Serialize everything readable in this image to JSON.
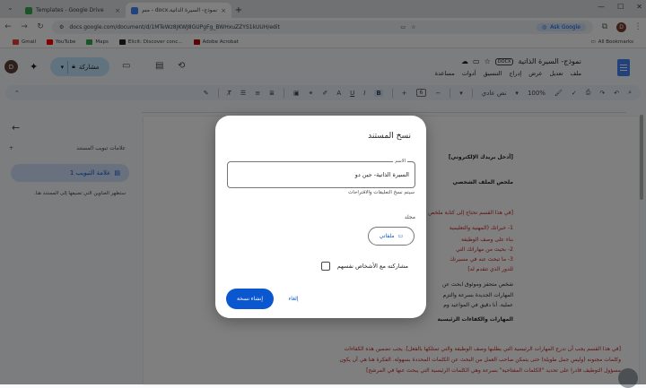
{
  "browser": {
    "tabs": [
      {
        "label": "Templates - Google Drive",
        "active": false
      },
      {
        "label": "نموذج- السيرة الذاتية.docx - مس",
        "active": true
      }
    ],
    "url": "docs.google.com/document/d/1MTeWz8JKWJ8GUPgFg_BWHxuZZYS1kUUH/edit",
    "ask_google": "Ask Google",
    "bookmarks": [
      "Gmail",
      "YouTube",
      "Maps",
      "Elicit: Discover conc...",
      "Adobe Acrobat"
    ],
    "all_bookmarks": "All Bookmarks"
  },
  "docs": {
    "avatar_letter": "D",
    "share_label": "مشاركة",
    "title": "نموذج- السيرة الذاتية",
    "badge": "DOCX",
    "menus": [
      "ملف",
      "تعديل",
      "عرض",
      "إدراج",
      "التنسيق",
      "أدوات",
      "مساعدة"
    ],
    "toolbar": {
      "zoom": "100%",
      "style": "نص عادي",
      "font_size": "6"
    }
  },
  "sidebar": {
    "heading": "علامات تبويب المستند",
    "tab_item": "علامة التبويب 1",
    "note": "ستظهر العناوين التي تضيفها إلى المستند هنا."
  },
  "document_lines": [
    {
      "text": "[أدخل بريدك الإلكتروني]",
      "style": "bold"
    },
    {
      "text": "ملخص الملف الشخصي",
      "style": "bold"
    },
    {
      "text": "[في هذا القسم تحتاج إلى كتابة ملخص",
      "style": "red"
    },
    {
      "text": "1- خبراتك (المهنية والتعليمية",
      "style": "red"
    },
    {
      "text": "بناء على وصف الوظيفة",
      "style": "red"
    },
    {
      "text": "2- بحيث من مهاراتك التي",
      "style": "red"
    },
    {
      "text": "3- ما تبحث عنه في مسيرتك",
      "style": "red"
    },
    {
      "text": "للدور الذي تتقدم له]",
      "style": "red"
    },
    {
      "text": "شخص متحفز وموثوق ابحث عن",
      "style": "dark"
    },
    {
      "text": "المهارات الجديدة بسرعة والتزم",
      "style": "dark"
    },
    {
      "text": "عملية. أنا دقيق في المواعيد وم",
      "style": "dark"
    },
    {
      "text": "المهارات والكفاءات الرئيسية",
      "style": "bold"
    },
    {
      "text": "[في هذا القسم يجب أن تدرج المهارات الرئيسية التي يطلبها وصف الوظيفة والتي تمتلكها بالفعل]. يجب تضمين هذه الكفاءات",
      "style": "red"
    },
    {
      "text": "وكلمات مجنونه (وليس جمل طويلة) حتى يتمكن صاحب العمل من البحث عن الكلمات المحددة بسهولة. الفكرة هنا هي أن يكون",
      "style": "red"
    },
    {
      "text": "مسؤول التوظيف قادرا على تحديد \"الكلمات المفتاحية\" بسرعة وهي الكلمات الرئيسية التي يبحث عنها في المرشح]",
      "style": "red"
    }
  ],
  "dialog": {
    "title": "نسخ المستند",
    "name_label": "الاسم",
    "name_value": "السيرة الذاتية- جين دو",
    "subnote": "سيتم نسخ التعليقات والاقتراحات",
    "folder_label": "مجلد",
    "folder_button": "ملفاتي",
    "share_checkbox": "مشاركته مع الأشخاص نفسهم",
    "share_checked": false,
    "create_button": "إنشاء نسخة",
    "cancel_button": "إلغاء"
  }
}
